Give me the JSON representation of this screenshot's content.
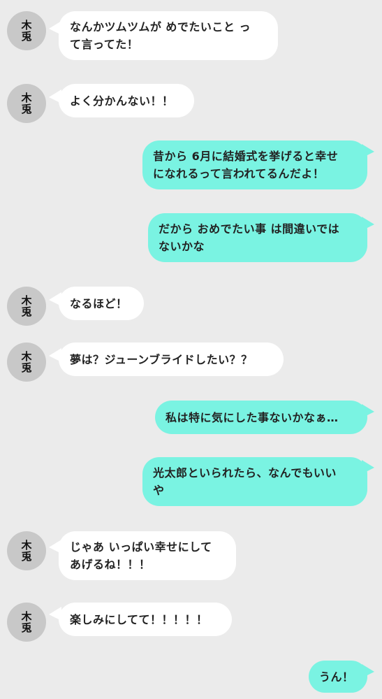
{
  "contact": {
    "avatar_line1": "木",
    "avatar_line2": "兎"
  },
  "messages": [
    {
      "from": "them",
      "text": "なんかツムツムが めでたいこと っ\nて言ってた！"
    },
    {
      "from": "them",
      "text": "よく分かんない！！"
    },
    {
      "from": "me",
      "text": "昔から 6月に結婚式を挙げると幸せ\nになれるって言われてるんだよ！"
    },
    {
      "from": "me",
      "text": "だから おめでたい事 は間違いでは\nないかな"
    },
    {
      "from": "them",
      "text": "なるほど！"
    },
    {
      "from": "them",
      "text": "夢は？ジューンブライドしたい？？"
    },
    {
      "from": "me",
      "text": "私は特に気にした事ないかなぁ…"
    },
    {
      "from": "me",
      "text": "光太郎といられたら、なんでもいい\nや"
    },
    {
      "from": "them",
      "text": "じゃあ いっぱい幸せにして\nあげるね！！！"
    },
    {
      "from": "them",
      "text": "楽しみにしてて！！！！！"
    },
    {
      "from": "me",
      "text": "うん！"
    }
  ],
  "colors": {
    "background": "#ebebeb",
    "incoming_bubble": "#ffffff",
    "outgoing_bubble": "#7af3e2",
    "avatar": "#c8c8c8"
  }
}
